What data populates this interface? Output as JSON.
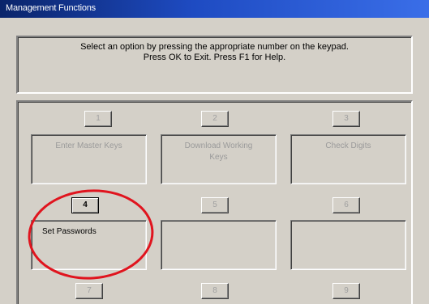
{
  "window": {
    "title": "Management Functions"
  },
  "instructions": {
    "line1": "Select an option by pressing the appropriate number on the keypad.",
    "line2": "Press OK to Exit.  Press F1 for Help."
  },
  "keys": [
    "1",
    "2",
    "3",
    "4",
    "5",
    "6",
    "7",
    "8",
    "9"
  ],
  "options": {
    "enter_master_keys": "Enter Master Keys",
    "download_working_keys_line1": "Download Working",
    "download_working_keys_line2": "Keys",
    "check_digits": "Check Digits",
    "set_passwords": "Set Passwords",
    "option_6": "",
    "option_7": ""
  },
  "colors": {
    "title_bar": "#0a246a",
    "highlight_ring": "#e0141e"
  }
}
